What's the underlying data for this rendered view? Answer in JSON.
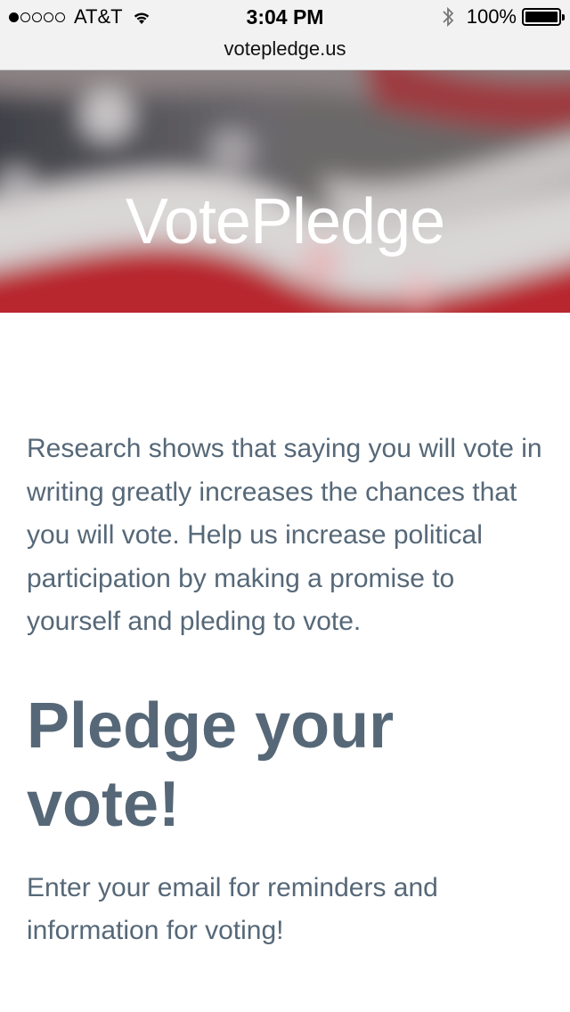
{
  "status_bar": {
    "carrier": "AT&T",
    "signal_dots_filled": 1,
    "signal_dots_total": 5,
    "time": "3:04 PM",
    "battery_percent": "100%",
    "icons": [
      "wifi-icon",
      "bluetooth-icon",
      "battery-icon"
    ]
  },
  "browser": {
    "url": "votepledge.us"
  },
  "hero": {
    "title": "VotePledge",
    "colors": {
      "red": "#b8262e",
      "white": "#d9d6d6",
      "navy": "#2b2f3d"
    }
  },
  "main": {
    "intro": "Research shows that saying you will vote in writing greatly increases the chances that you will vote. Help us increase political participation by making a promise to yourself and pleding to vote.",
    "pledge_title": "Pledge your vote!",
    "pledge_subtitle": "Enter your email for reminders and information for voting!"
  },
  "colors": {
    "text": "#566878",
    "status_bg": "#f2f2f2"
  }
}
